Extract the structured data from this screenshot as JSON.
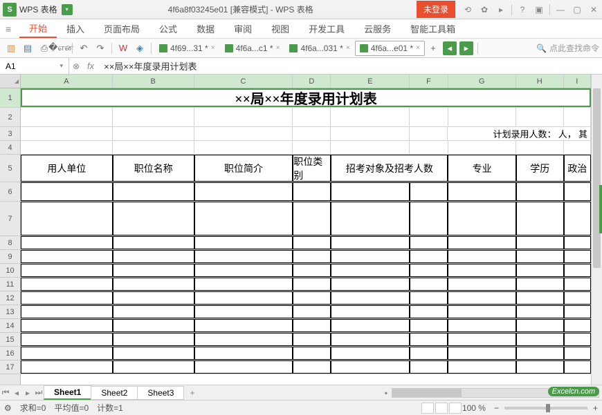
{
  "titlebar": {
    "appname": "WPS 表格",
    "docname": "4f6a8f03245e01 [兼容模式] - WPS 表格",
    "login": "未登录"
  },
  "menu": {
    "items": [
      "开始",
      "插入",
      "页面布局",
      "公式",
      "数据",
      "审阅",
      "视图",
      "开发工具",
      "云服务",
      "智能工具箱"
    ]
  },
  "tabs": [
    {
      "label": "4f69...31 *"
    },
    {
      "label": "4f6a...c1 *"
    },
    {
      "label": "4f6a...031 *"
    },
    {
      "label": "4f6a...e01 *",
      "active": true
    }
  ],
  "search": {
    "placeholder": "点此查找命令"
  },
  "refbar": {
    "cell": "A1",
    "formula": "××局××年度录用计划表"
  },
  "sheet": {
    "cols": [
      "A",
      "B",
      "C",
      "D",
      "E",
      "F",
      "G",
      "H",
      "I"
    ],
    "title": "××局××年度录用计划表",
    "plannote": "计划录用人数：   人，  其",
    "headers": [
      "用人单位",
      "职位名称",
      "职位简介",
      "职位类别",
      "招考对象及招考人数",
      "",
      "专业",
      "学历",
      "政治"
    ]
  },
  "sheets": [
    "Sheet1",
    "Sheet2",
    "Sheet3"
  ],
  "status": {
    "sum": "求和=0",
    "avg": "平均值=0",
    "count": "计数=1",
    "zoom": "100 %"
  },
  "watermark": "Excelcn.com"
}
